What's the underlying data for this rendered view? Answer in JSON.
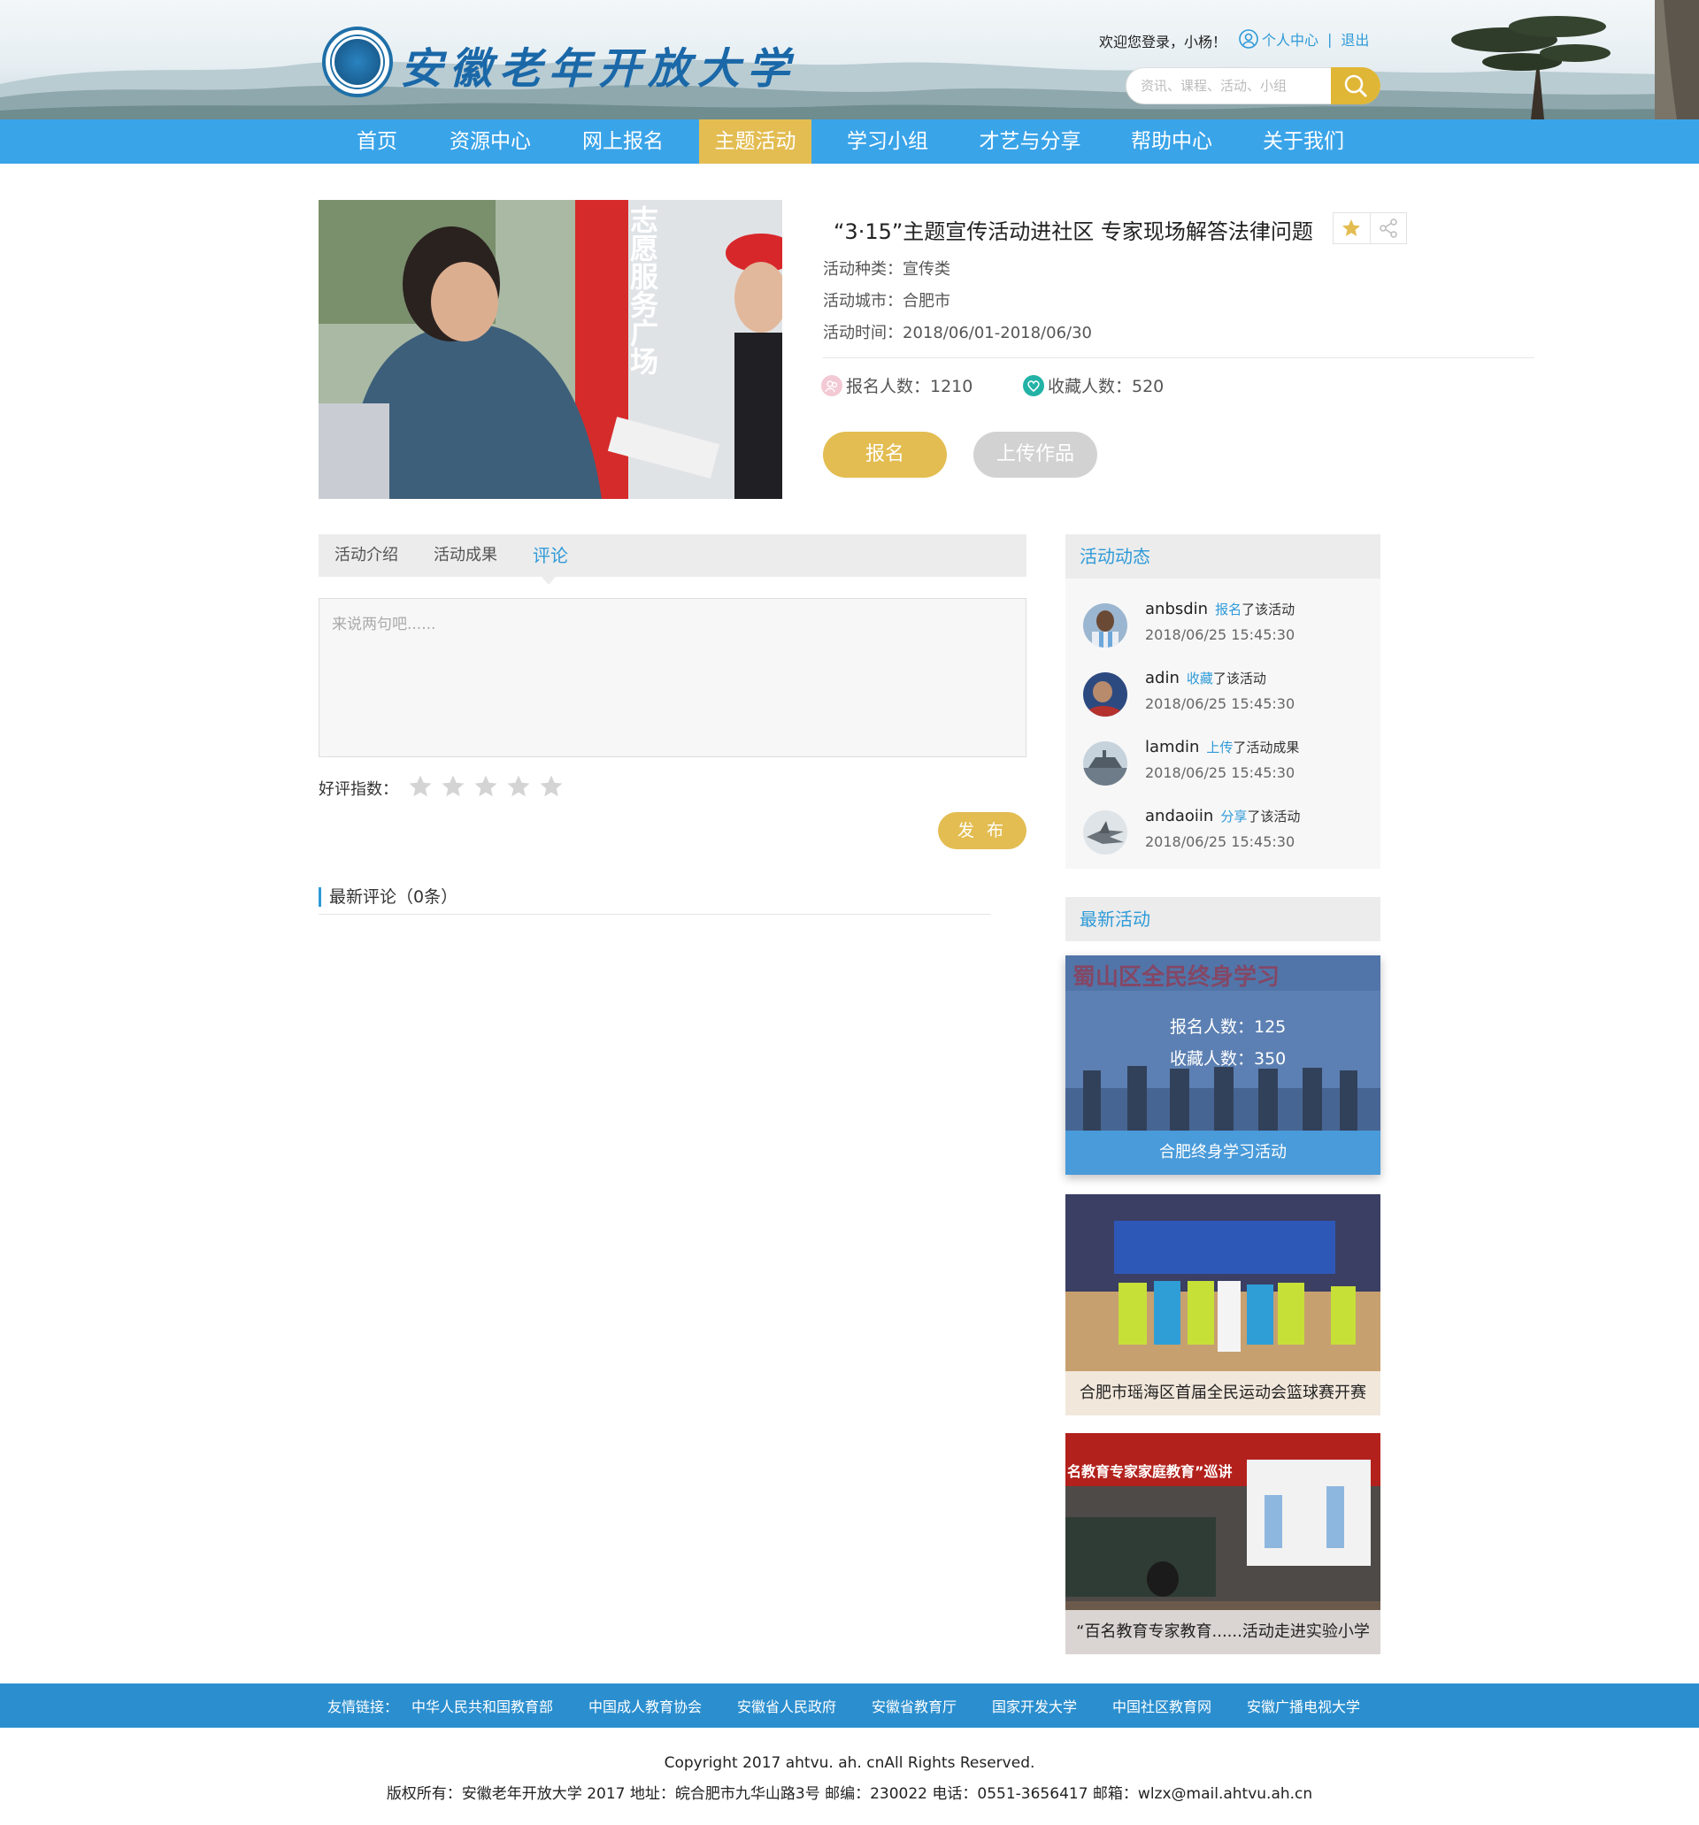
{
  "header": {
    "brand": "安徽老年开放大学",
    "welcome": "欢迎您登录，小杨！",
    "user_center": "个人中心",
    "separator": "|",
    "logout": "退出",
    "search_placeholder": "资讯、课程、活动、小组"
  },
  "nav": {
    "items": [
      "首页",
      "资源中心",
      "网上报名",
      "主题活动",
      "学习小组",
      "才艺与分享",
      "帮助中心",
      "关于我们"
    ],
    "active": "主题活动"
  },
  "activity": {
    "title": "“3·15”主题宣传活动进社区 专家现场解答法律问题",
    "type": "活动种类：宣传类",
    "city": "活动城市：合肥市",
    "time": "活动时间：2018/06/01-2018/06/30",
    "signup_count": "报名人数：1210",
    "favorite_count": "收藏人数：520",
    "signup_button": "报名",
    "upload_button": "上传作品",
    "banner_text": "志愿服务广场"
  },
  "tabs": {
    "items": [
      "活动介绍",
      "活动成果",
      "评论"
    ],
    "active": "评论"
  },
  "comment": {
    "placeholder": "来说两句吧......",
    "rating_label": "好评指数：",
    "stars": 5,
    "rating_value": 0,
    "publish_button": "发 布",
    "latest_header": "最新评论（0条）"
  },
  "sidebar": {
    "feed_title": "活动动态",
    "feed": [
      {
        "name": "anbsdin",
        "action": "报名",
        "rest": "了该活动",
        "time": "2018/06/25  15:45:30"
      },
      {
        "name": "adin",
        "action": "收藏",
        "rest": "了该活动",
        "time": "2018/06/25  15:45:30"
      },
      {
        "name": "lamdin",
        "action": "上传",
        "rest": "了活动成果",
        "time": "2018/06/25  15:45:30"
      },
      {
        "name": "andaoiin",
        "action": "分享",
        "rest": "了该活动",
        "time": "2018/06/25  15:45:30"
      }
    ],
    "latest_title": "最新活动",
    "cards": [
      {
        "caption": "合肥终身学习活动",
        "signup": "报名人数：125",
        "favorite": "收藏人数：350",
        "banner": "蜀山区全民终身学习"
      },
      {
        "caption": "合肥市瑶海区首届全民运动会篮球赛开赛"
      },
      {
        "caption": "“百名教育专家教育......活动走进实验小学",
        "banner": "名教育专家家庭教育”巡讲"
      }
    ]
  },
  "footer": {
    "links_label": "友情链接：",
    "links": [
      "中华人民共和国教育部",
      "中国成人教育协会",
      "安徽省人民政府",
      "安徽省教育厅",
      "国家开发大学",
      "中国社区教育网",
      "安徽广播电视大学"
    ],
    "copyright": "Copyright 2017 ahtvu. ah. cnAll Rights Reserved.",
    "info": "版权所有：安徽老年开放大学 2017 地址：皖合肥市九华山路3号 邮编：230022 电话：0551-3656417 邮箱：wlzx@mail.ahtvu.ah.cn"
  },
  "colors": {
    "nav_blue": "#3aa4e9",
    "accent_gold": "#e3bd52",
    "link_blue": "#2e9ad8",
    "footer_blue": "#2b8fcf"
  }
}
